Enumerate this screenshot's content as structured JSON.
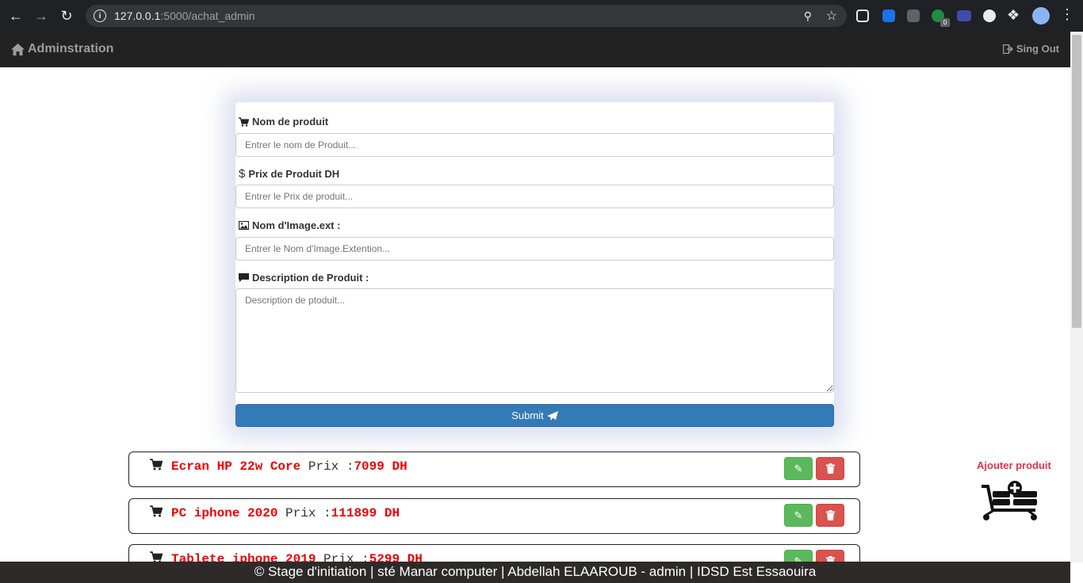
{
  "browser": {
    "url_host": "127.0.0.1",
    "url_path": ":5000/achat_admin",
    "extension_badge": "0"
  },
  "navbar": {
    "brand": "Adminstration",
    "signout": "Sing Out"
  },
  "form": {
    "name_label": "Nom de produit",
    "name_placeholder": "Entrer le nom de Produit...",
    "price_label": "Prix de Produit DH",
    "price_placeholder": "Entrer le Prix de produit...",
    "image_label": "Nom d'Image.ext :",
    "image_placeholder": "Entrer le Nom d'Image.Extention...",
    "desc_label": "Description de Produit :",
    "desc_placeholder": "Description de ptoduit...",
    "submit_label": "Submit"
  },
  "products": [
    {
      "name": "Ecran HP 22w Core",
      "price_label": "Prix :",
      "price": "7099 DH"
    },
    {
      "name": "PC iphone 2020",
      "price_label": "Prix :",
      "price": "111899 DH"
    },
    {
      "name": "Tablete iphone 2019",
      "price_label": "Prix :",
      "price": "5299 DH"
    }
  ],
  "side": {
    "add_product": "Ajouter produit"
  },
  "footer": {
    "text": "© Stage d'initiation | sté Manar computer | Abdellah ELAAROUB - admin | IDSD Est Essaouira"
  },
  "colors": {
    "navbar_bg": "#222222",
    "primary": "#337ab7",
    "success": "#5cb85c",
    "danger": "#d9534f",
    "product_text": "#ee0000",
    "add_link": "#e0334a"
  }
}
